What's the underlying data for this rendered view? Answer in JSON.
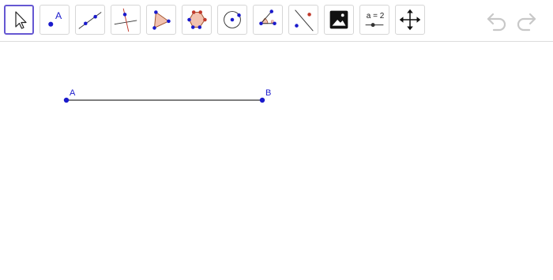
{
  "toolbar": {
    "tools": [
      {
        "id": "move",
        "icon": "move-cursor-icon",
        "active": true
      },
      {
        "id": "point",
        "icon": "point-icon",
        "label": "A"
      },
      {
        "id": "line",
        "icon": "line-icon"
      },
      {
        "id": "perpendicular",
        "icon": "perpendicular-line-icon"
      },
      {
        "id": "polygon",
        "icon": "polygon-icon"
      },
      {
        "id": "regular-polygon",
        "icon": "regular-polygon-icon"
      },
      {
        "id": "circle",
        "icon": "circle-icon"
      },
      {
        "id": "angle",
        "icon": "angle-icon",
        "label": "α"
      },
      {
        "id": "reflect",
        "icon": "reflect-icon"
      },
      {
        "id": "image",
        "icon": "image-icon"
      },
      {
        "id": "slider",
        "icon": "slider-icon",
        "label": "a = 2"
      },
      {
        "id": "move-graphics-view",
        "icon": "move-arrows-icon"
      }
    ],
    "undo_icon": "undo-icon",
    "redo_icon": "redo-icon"
  },
  "canvas": {
    "points": [
      {
        "name": "A"
      },
      {
        "name": "B"
      }
    ],
    "segment": "AB",
    "colors": {
      "point": "#1a1acc",
      "segment": "#333333",
      "polygon_fill": "#f2c2b0",
      "accent": "#6557d2"
    }
  }
}
